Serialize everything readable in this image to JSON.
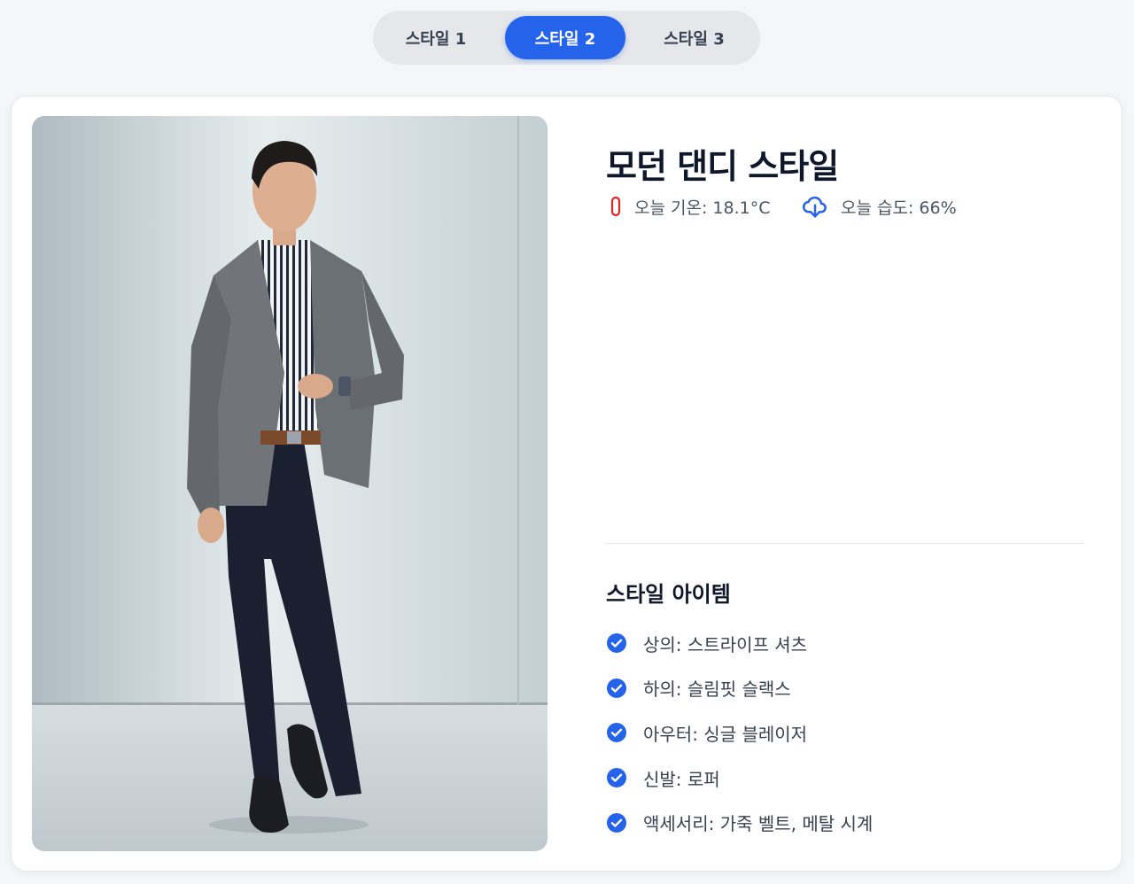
{
  "tabs": [
    {
      "label": "스타일 1",
      "active": false
    },
    {
      "label": "스타일 2",
      "active": true
    },
    {
      "label": "스타일 3",
      "active": false
    }
  ],
  "style": {
    "title": "모던 댄디 스타일",
    "temperature_text": "오늘 기온: 18.1°C",
    "humidity_text": "오늘 습도: 66%"
  },
  "items_section": {
    "title": "스타일 아이템",
    "items": [
      "상의: 스트라이프 셔츠",
      "하의: 슬림핏 슬랙스",
      "아우터: 싱글 블레이저",
      "신발: 로퍼",
      "액세서리: 가죽 벨트, 메탈 시계"
    ]
  },
  "icons": {
    "temperature": "thermometer-icon",
    "humidity": "cloud-download-icon",
    "item": "check-circle-icon"
  },
  "colors": {
    "accent": "#2563eb",
    "temperature_icon": "#dc2626",
    "humidity_icon": "#2563eb",
    "check": "#2563eb"
  }
}
